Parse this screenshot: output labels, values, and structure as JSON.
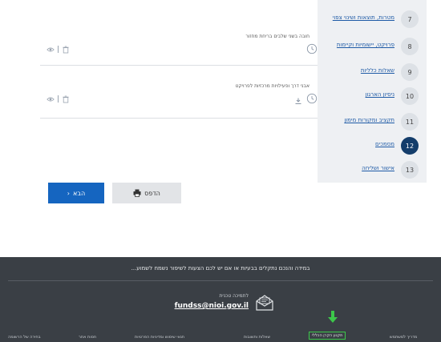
{
  "steps": [
    {
      "num": "7",
      "label": "מטרות, תוצאות ושינוי צפוי"
    },
    {
      "num": "8",
      "label": "פרויקט, יישומיות וקיימות"
    },
    {
      "num": "9",
      "label": "שאלות כלליות"
    },
    {
      "num": "10",
      "label": "ניסיון הארגון"
    },
    {
      "num": "11",
      "label": "תקציב ומקורות מימון"
    },
    {
      "num": "12",
      "label": "מסמכים"
    },
    {
      "num": "13",
      "label": "אישור ושליחה"
    }
  ],
  "active_step": "12",
  "form_rows": [
    {
      "label": "חובה בשני שלבים בריחת מחזור"
    },
    {
      "label": "אבני דרך ופעילויות מרכזיות לפרויקט"
    }
  ],
  "buttons": {
    "next_label": "הבא",
    "print_label": "הדפס"
  },
  "footer": {
    "message": "במידה והנכם נתקלים בבעיות או אם יש לכם הצעות לשיפור נשמח לשמוע...",
    "support_label": "לתמיכה טכנית",
    "support_email": "fundss@nioi.gov.il",
    "links": [
      "בחירה של הרשומה",
      "חסות אתר",
      "תנאי שימוש ומדיניות הפרטיות",
      "שאלות ותשובות",
      "תקנון הקרן הכללי",
      "מדריך למשתמש"
    ]
  },
  "colors": {
    "primary": "#1565c0",
    "active_step": "#143d6b",
    "footer_bg": "#3a3f45",
    "highlight": "#3cc84a"
  }
}
